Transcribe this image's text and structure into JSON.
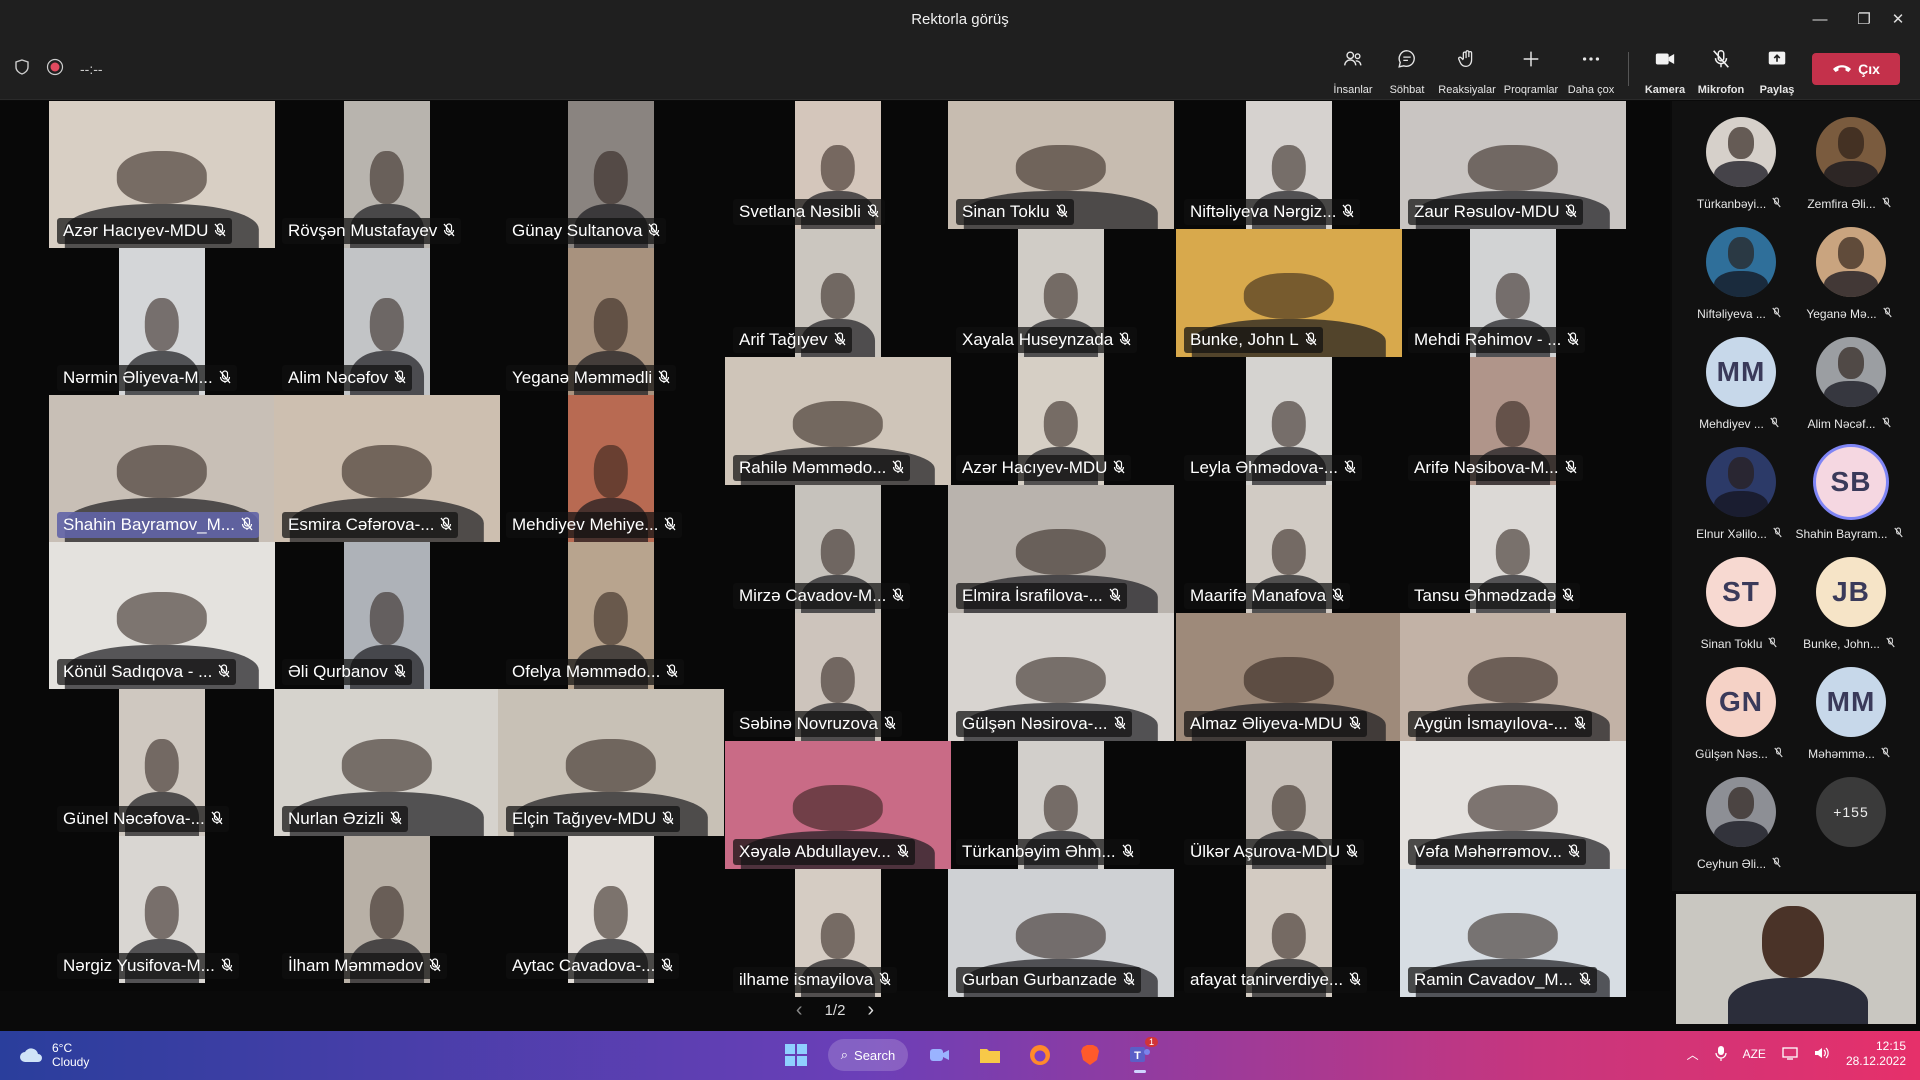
{
  "window": {
    "title": "Rektorla görüş",
    "minimize": "—",
    "restore": "❐",
    "close": "✕"
  },
  "toolbar": {
    "timer": "--:--",
    "people": "İnsanlar",
    "chat": "Söhbat",
    "reactions": "Reaksiyalar",
    "apps": "Proqramlar",
    "more": "Daha çox",
    "camera": "Kamera",
    "mic": "Mikrofon",
    "share": "Paylaş",
    "leave": "Çıx"
  },
  "grid": {
    "left": [
      {
        "name": "Azər Hacıyev-MDU",
        "bg": "#d8cfc4",
        "highlight": false
      },
      {
        "name": "Rövşən Mustafayev",
        "bg": "#b8b4ae",
        "highlight": false
      },
      {
        "name": "Günay Sultanova",
        "bg": "#8a8480",
        "highlight": false
      },
      {
        "name": "Nərmin Əliyeva-M...",
        "bg": "#d4d6d8",
        "highlight": false
      },
      {
        "name": "Alim Nəcəfov",
        "bg": "#c2c4c6",
        "highlight": false
      },
      {
        "name": "Yeganə Məmmədli",
        "bg": "#a8927e",
        "highlight": false
      },
      {
        "name": "Shahin Bayramov_M...",
        "bg": "#c8bfb6",
        "highlight": true
      },
      {
        "name": "Esmira Cəfərova-...",
        "bg": "#cdbfb0",
        "highlight": false
      },
      {
        "name": "Mehdiyev Mehiye...",
        "bg": "#b86a52",
        "highlight": false
      },
      {
        "name": "Könül Sadıqova - ...",
        "bg": "#e4e2de",
        "highlight": false
      },
      {
        "name": "Əli Qurbanov",
        "bg": "#aeb2b8",
        "highlight": false
      },
      {
        "name": "Ofelya Məmmədo...",
        "bg": "#b8a48e",
        "highlight": false
      },
      {
        "name": "Günel Nəcəfova-...",
        "bg": "#cfc8c0",
        "highlight": false
      },
      {
        "name": "Nurlan Əzizli",
        "bg": "#d6d3cd",
        "highlight": false
      },
      {
        "name": "Elçin Tağıyev-MDU",
        "bg": "#c8c1b6",
        "highlight": false
      },
      {
        "name": "Nərgiz Yusifova-M...",
        "bg": "#d9d6d2",
        "highlight": false
      },
      {
        "name": "İlham Məmmədov",
        "bg": "#b8b0a6",
        "highlight": false
      },
      {
        "name": "Aytac Cavadova-...",
        "bg": "#e2ddd8",
        "highlight": false
      }
    ],
    "right": [
      {
        "name": "Svetlana Nəsibli",
        "bg": "#d4c6bb"
      },
      {
        "name": "Sinan Toklu",
        "bg": "#c7bcb0"
      },
      {
        "name": "Niftəliyeva Nərgiz...",
        "bg": "#d6d2cf"
      },
      {
        "name": "Zaur Rəsulov-MDU",
        "bg": "#c9c5c2"
      },
      {
        "name": "Arif Tağıyev",
        "bg": "#cbc6bf"
      },
      {
        "name": "Xayala Huseynzada",
        "bg": "#d0ccc6"
      },
      {
        "name": "Bunke, John L",
        "bg": "#d8a94c"
      },
      {
        "name": "Mehdi Rəhimov - ...",
        "bg": "#d2d3d4"
      },
      {
        "name": "Rahilə Məmmədo...",
        "bg": "#cfc5b9"
      },
      {
        "name": "Azər Hacıyev-MDU",
        "bg": "#d6cfc5"
      },
      {
        "name": "Leyla Əhmədova-...",
        "bg": "#d5d3d0"
      },
      {
        "name": "Arifə Nəsibova-M...",
        "bg": "#b0958a"
      },
      {
        "name": "Mirzə Cavadov-M...",
        "bg": "#c6c2bc"
      },
      {
        "name": "Elmira İsrafilova-...",
        "bg": "#b9b3ad"
      },
      {
        "name": "Maarifə Manafova",
        "bg": "#d1cbc4"
      },
      {
        "name": "Tansu Əhmədzadə",
        "bg": "#dcd9d6"
      },
      {
        "name": "Səbinə Novruzova",
        "bg": "#cdc4bc"
      },
      {
        "name": "Gülşən Nəsirova-...",
        "bg": "#d8d4d0"
      },
      {
        "name": "Almaz Əliyeva-MDU",
        "bg": "#9e8a7a"
      },
      {
        "name": "Aygün İsmayılova-...",
        "bg": "#c2b2a6"
      },
      {
        "name": "Xəyalə Abdullayev...",
        "bg": "#c96b86"
      },
      {
        "name": "Türkanbəyim Əhm...",
        "bg": "#d2cfcb"
      },
      {
        "name": "Ülkər Aşurova-MDU",
        "bg": "#c7c0b9"
      },
      {
        "name": "Vəfa Məhərrəmov...",
        "bg": "#e4e1de"
      },
      {
        "name": "ilhame ismayilova",
        "bg": "#d5ccc3"
      },
      {
        "name": "Gurban Gurbanzade",
        "bg": "#cfd1d4"
      },
      {
        "name": "afayat tanirverdiye...",
        "bg": "#d3cbc2"
      },
      {
        "name": "Ramin Cavadov_M...",
        "bg": "#d7dde3"
      }
    ]
  },
  "pager": {
    "prev": "‹",
    "label": "1/2",
    "next": "›"
  },
  "sidebar": [
    {
      "name": "Türkanbəyi...",
      "type": "photo",
      "color": "#d6d0ca",
      "initials": ""
    },
    {
      "name": "Zemfira Əli...",
      "type": "photo",
      "color": "#7a5b3e",
      "initials": ""
    },
    {
      "name": "Niftəliyeva ...",
      "type": "photo",
      "color": "#2f6f9a",
      "initials": ""
    },
    {
      "name": "Yeganə Mə...",
      "type": "photo",
      "color": "#c9a47f",
      "initials": ""
    },
    {
      "name": "Mehdiyev ...",
      "type": "initials",
      "color": "#c7d8ea",
      "initials": "MM"
    },
    {
      "name": "Alim Nəcəf...",
      "type": "photo",
      "color": "#9b9ea2",
      "initials": ""
    },
    {
      "name": "Elnur Xəlilo...",
      "type": "photo",
      "color": "#2c3a68",
      "initials": ""
    },
    {
      "name": "Shahin Bayram...",
      "type": "initials",
      "color": "#f5d7e1",
      "initials": "SB"
    },
    {
      "name": "Sinan Toklu",
      "type": "initials",
      "color": "#f7d9d1",
      "initials": "ST"
    },
    {
      "name": "Bunke, John...",
      "type": "initials",
      "color": "#f6e4c7",
      "initials": "JB"
    },
    {
      "name": "Gülşən Nəs...",
      "type": "initials",
      "color": "#f5d2c6",
      "initials": "GN"
    },
    {
      "name": "Məhəmmə...",
      "type": "initials",
      "color": "#c7d8ea",
      "initials": "MM"
    },
    {
      "name": "Ceyhun Əli...",
      "type": "photo",
      "color": "#8d8f95",
      "initials": ""
    }
  ],
  "overflow": "+155",
  "taskbar": {
    "temp": "6°C",
    "weather": "Cloudy",
    "search": "Search",
    "lang": "AZE",
    "time": "12:15",
    "date": "28.12.2022",
    "teams_badge": "1"
  }
}
